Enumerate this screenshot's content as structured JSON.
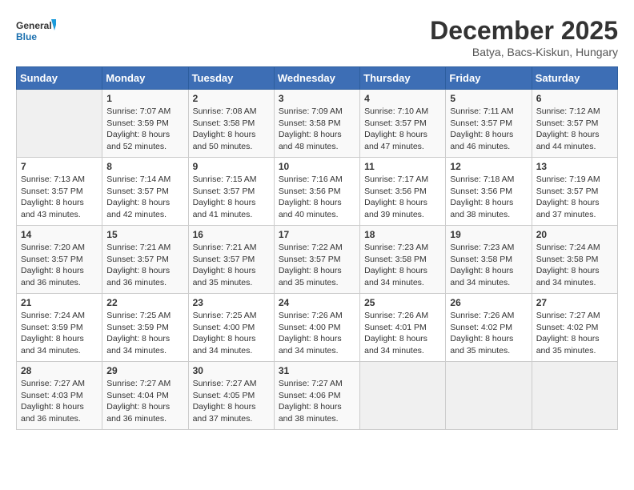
{
  "header": {
    "logo_line1": "General",
    "logo_line2": "Blue",
    "month_year": "December 2025",
    "location": "Batya, Bacs-Kiskun, Hungary"
  },
  "weekdays": [
    "Sunday",
    "Monday",
    "Tuesday",
    "Wednesday",
    "Thursday",
    "Friday",
    "Saturday"
  ],
  "weeks": [
    [
      {
        "day": "",
        "info": ""
      },
      {
        "day": "1",
        "info": "Sunrise: 7:07 AM\nSunset: 3:59 PM\nDaylight: 8 hours\nand 52 minutes."
      },
      {
        "day": "2",
        "info": "Sunrise: 7:08 AM\nSunset: 3:58 PM\nDaylight: 8 hours\nand 50 minutes."
      },
      {
        "day": "3",
        "info": "Sunrise: 7:09 AM\nSunset: 3:58 PM\nDaylight: 8 hours\nand 48 minutes."
      },
      {
        "day": "4",
        "info": "Sunrise: 7:10 AM\nSunset: 3:57 PM\nDaylight: 8 hours\nand 47 minutes."
      },
      {
        "day": "5",
        "info": "Sunrise: 7:11 AM\nSunset: 3:57 PM\nDaylight: 8 hours\nand 46 minutes."
      },
      {
        "day": "6",
        "info": "Sunrise: 7:12 AM\nSunset: 3:57 PM\nDaylight: 8 hours\nand 44 minutes."
      }
    ],
    [
      {
        "day": "7",
        "info": "Sunrise: 7:13 AM\nSunset: 3:57 PM\nDaylight: 8 hours\nand 43 minutes."
      },
      {
        "day": "8",
        "info": "Sunrise: 7:14 AM\nSunset: 3:57 PM\nDaylight: 8 hours\nand 42 minutes."
      },
      {
        "day": "9",
        "info": "Sunrise: 7:15 AM\nSunset: 3:57 PM\nDaylight: 8 hours\nand 41 minutes."
      },
      {
        "day": "10",
        "info": "Sunrise: 7:16 AM\nSunset: 3:56 PM\nDaylight: 8 hours\nand 40 minutes."
      },
      {
        "day": "11",
        "info": "Sunrise: 7:17 AM\nSunset: 3:56 PM\nDaylight: 8 hours\nand 39 minutes."
      },
      {
        "day": "12",
        "info": "Sunrise: 7:18 AM\nSunset: 3:56 PM\nDaylight: 8 hours\nand 38 minutes."
      },
      {
        "day": "13",
        "info": "Sunrise: 7:19 AM\nSunset: 3:57 PM\nDaylight: 8 hours\nand 37 minutes."
      }
    ],
    [
      {
        "day": "14",
        "info": "Sunrise: 7:20 AM\nSunset: 3:57 PM\nDaylight: 8 hours\nand 36 minutes."
      },
      {
        "day": "15",
        "info": "Sunrise: 7:21 AM\nSunset: 3:57 PM\nDaylight: 8 hours\nand 36 minutes."
      },
      {
        "day": "16",
        "info": "Sunrise: 7:21 AM\nSunset: 3:57 PM\nDaylight: 8 hours\nand 35 minutes."
      },
      {
        "day": "17",
        "info": "Sunrise: 7:22 AM\nSunset: 3:57 PM\nDaylight: 8 hours\nand 35 minutes."
      },
      {
        "day": "18",
        "info": "Sunrise: 7:23 AM\nSunset: 3:58 PM\nDaylight: 8 hours\nand 34 minutes."
      },
      {
        "day": "19",
        "info": "Sunrise: 7:23 AM\nSunset: 3:58 PM\nDaylight: 8 hours\nand 34 minutes."
      },
      {
        "day": "20",
        "info": "Sunrise: 7:24 AM\nSunset: 3:58 PM\nDaylight: 8 hours\nand 34 minutes."
      }
    ],
    [
      {
        "day": "21",
        "info": "Sunrise: 7:24 AM\nSunset: 3:59 PM\nDaylight: 8 hours\nand 34 minutes."
      },
      {
        "day": "22",
        "info": "Sunrise: 7:25 AM\nSunset: 3:59 PM\nDaylight: 8 hours\nand 34 minutes."
      },
      {
        "day": "23",
        "info": "Sunrise: 7:25 AM\nSunset: 4:00 PM\nDaylight: 8 hours\nand 34 minutes."
      },
      {
        "day": "24",
        "info": "Sunrise: 7:26 AM\nSunset: 4:00 PM\nDaylight: 8 hours\nand 34 minutes."
      },
      {
        "day": "25",
        "info": "Sunrise: 7:26 AM\nSunset: 4:01 PM\nDaylight: 8 hours\nand 34 minutes."
      },
      {
        "day": "26",
        "info": "Sunrise: 7:26 AM\nSunset: 4:02 PM\nDaylight: 8 hours\nand 35 minutes."
      },
      {
        "day": "27",
        "info": "Sunrise: 7:27 AM\nSunset: 4:02 PM\nDaylight: 8 hours\nand 35 minutes."
      }
    ],
    [
      {
        "day": "28",
        "info": "Sunrise: 7:27 AM\nSunset: 4:03 PM\nDaylight: 8 hours\nand 36 minutes."
      },
      {
        "day": "29",
        "info": "Sunrise: 7:27 AM\nSunset: 4:04 PM\nDaylight: 8 hours\nand 36 minutes."
      },
      {
        "day": "30",
        "info": "Sunrise: 7:27 AM\nSunset: 4:05 PM\nDaylight: 8 hours\nand 37 minutes."
      },
      {
        "day": "31",
        "info": "Sunrise: 7:27 AM\nSunset: 4:06 PM\nDaylight: 8 hours\nand 38 minutes."
      },
      {
        "day": "",
        "info": ""
      },
      {
        "day": "",
        "info": ""
      },
      {
        "day": "",
        "info": ""
      }
    ]
  ]
}
